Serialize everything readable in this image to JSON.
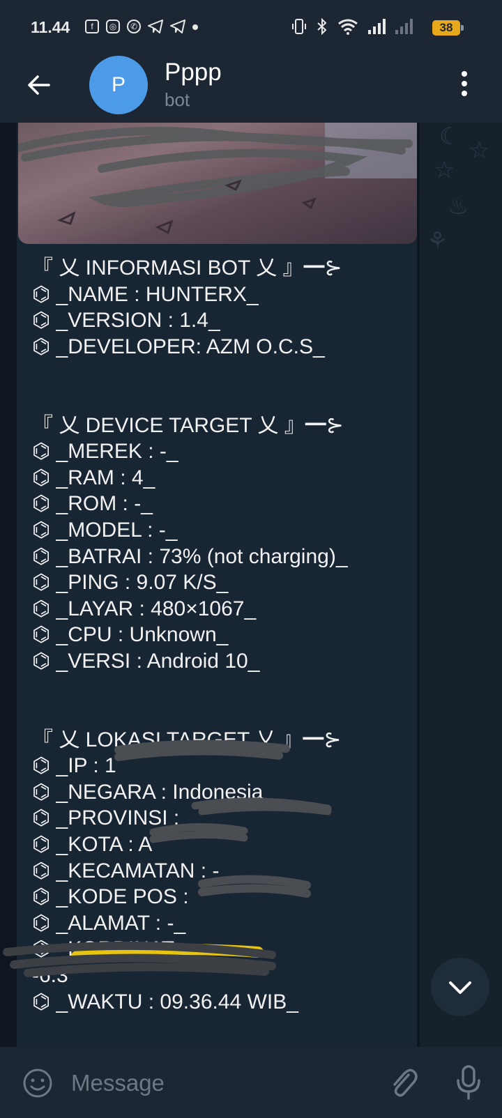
{
  "status_bar": {
    "time": "11.44",
    "battery": "38",
    "left_icons": [
      "facebook-icon",
      "instagram-icon",
      "whatsapp-icon",
      "telegram-icon",
      "telegram-icon",
      "dot-icon"
    ],
    "right_icons": [
      "vibrate-icon",
      "bluetooth-icon",
      "wifi-icon",
      "signal-icon",
      "signal-icon"
    ]
  },
  "header": {
    "avatar_letter": "P",
    "title": "Pppp",
    "subtitle": "bot",
    "avatar_color": "#4b9be8"
  },
  "message": {
    "lines": [
      "『 乂 INFORMASI BOT 乂 』━⊱",
      "⌬ _NAME : HUNTERX_",
      "⌬ _VERSION : 1.4_",
      "⌬ _DEVELOPER: AZM O.C.S_",
      "",
      "",
      "『 乂 DEVICE TARGET 乂 』━⊱",
      "⌬ _MEREK : -_",
      "⌬ _RAM : 4_",
      "⌬ _ROM : -_",
      "⌬ _MODEL : -_",
      "⌬ _BATRAI : 73% (not charging)_",
      "⌬ _PING : 9.07 K/S_",
      "⌬ _LAYAR : 480×1067_",
      "⌬ _CPU : Unknown_",
      "⌬ _VERSI : Android 10_",
      "",
      "",
      "『 乂 LOKASI TARGET 乂 』━⊱",
      "⌬ _IP : 1",
      "⌬ _NEGARA : Indonesia_",
      "⌬ _PROVINSI :",
      "⌬ _KOTA : A",
      "⌬ _KECAMATAN : -_",
      "⌬ _KODE POS :",
      "⌬ _ALAMAT : -_",
      "⌬ _KORDINAT :",
      "-6.3",
      "⌬ _WAKTU : 09.36.44 WIB_",
      ""
    ]
  },
  "input": {
    "placeholder": "Message"
  },
  "colors": {
    "header_bg": "#1d2733",
    "chat_bg": "#0e1621",
    "bubble_bg": "#182533",
    "accent": "#4b9be8"
  }
}
